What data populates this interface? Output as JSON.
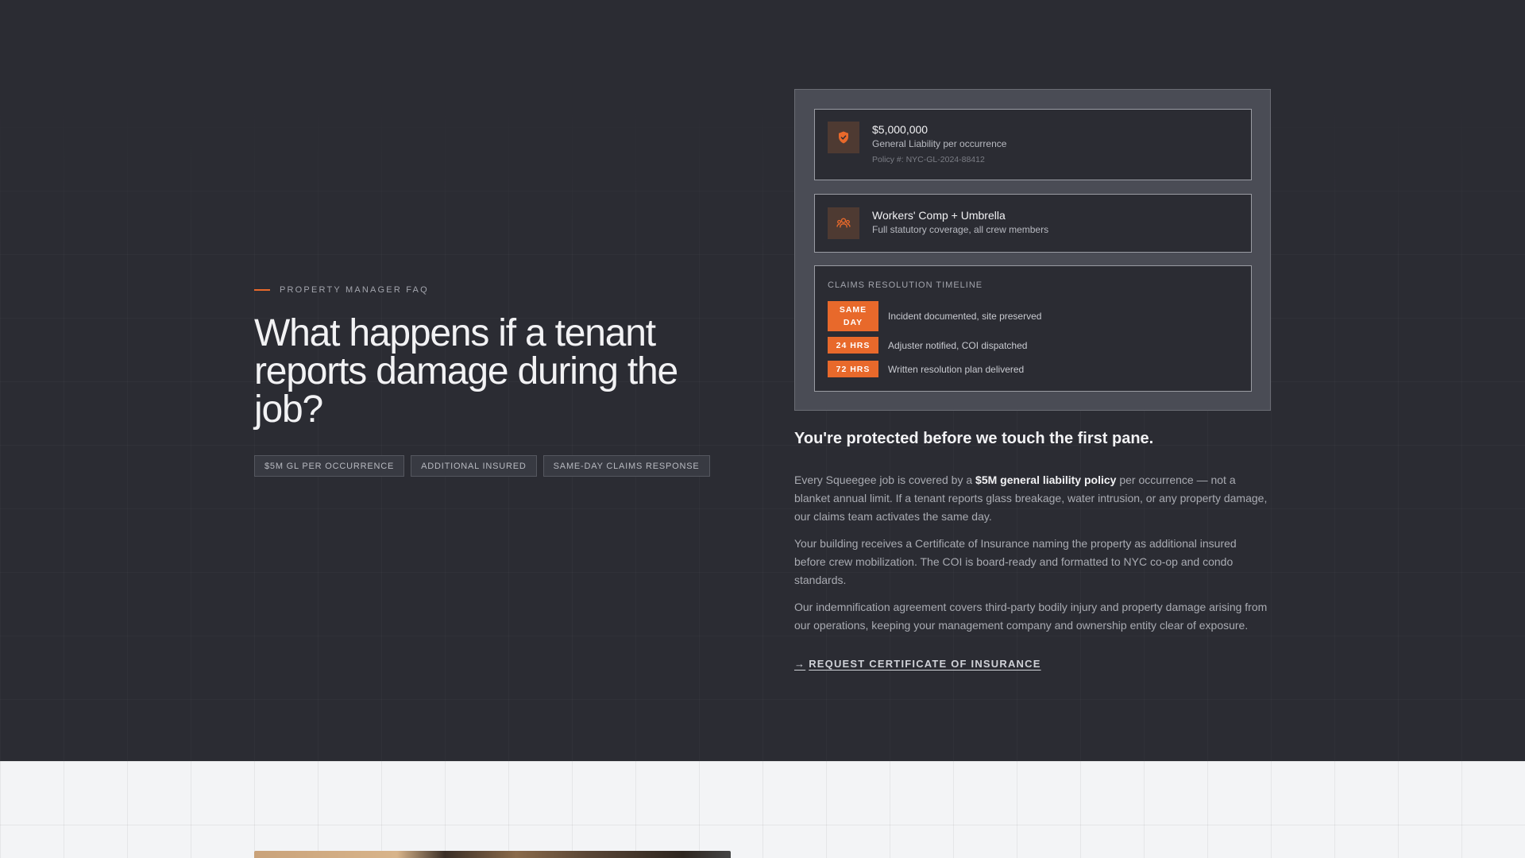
{
  "eyebrow": "PROPERTY MANAGER FAQ",
  "headline": "What happens if a tenant reports damage during the job?",
  "tags": [
    "$5M GL PER OCCURRENCE",
    "ADDITIONAL INSURED",
    "SAME-DAY CLAIMS RESPONSE"
  ],
  "coverage": {
    "general_liability": {
      "amount": "$5,000,000",
      "label": "General Liability per occurrence",
      "policy": "Policy #: NYC-GL-2024-88412",
      "icon": "shield-check-icon"
    },
    "workers_comp": {
      "title": "Workers' Comp + Umbrella",
      "label": "Full statutory coverage, all crew members",
      "icon": "crew-icon"
    }
  },
  "timeline": {
    "label": "CLAIMS RESOLUTION TIMELINE",
    "steps": [
      {
        "badge": "SAME DAY",
        "text": "Incident documented, site preserved"
      },
      {
        "badge": "24 HRS",
        "text": "Adjuster notified, COI dispatched"
      },
      {
        "badge": "72 HRS",
        "text": "Written resolution plan delivered"
      }
    ]
  },
  "copy": {
    "subhead": "You're protected before we touch the first pane.",
    "p1_before": "Every Squeegee job is covered by a ",
    "p1_bold": "$5M general liability policy",
    "p1_after": " per occurrence — not a blanket annual limit. If a tenant reports glass breakage, water intrusion, or any property damage, our claims team activates the same day.",
    "p2": "Your building receives a Certificate of Insurance naming the property as additional insured before crew mobilization. The COI is board-ready and formatted to NYC co-op and condo standards.",
    "p3": "Our indemnification agreement covers third-party bodily injury and property damage arising from our operations, keeping your management company and ownership entity clear of exposure."
  },
  "cta": {
    "arrow": "→",
    "label": "REQUEST CERTIFICATE OF INSURANCE"
  },
  "colors": {
    "accent": "#e8692b",
    "background": "#2b2c33"
  }
}
